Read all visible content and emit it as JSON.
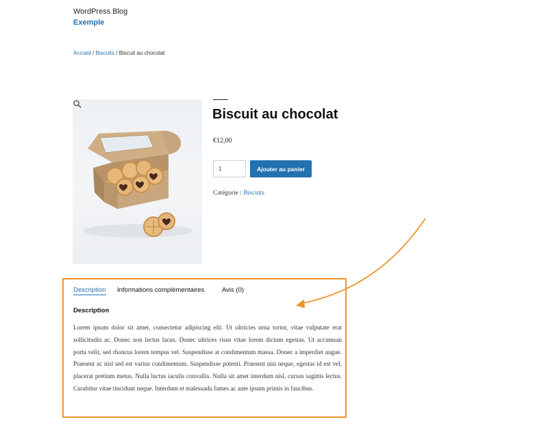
{
  "header": {
    "site_title": "WordPress Blog",
    "tagline": "Exemple"
  },
  "breadcrumb": {
    "home": "Accueil",
    "sep1": " / ",
    "category": "Biscuits",
    "sep2": " / ",
    "current": "Biscuit au chocolat"
  },
  "product": {
    "image_alt": "Biscuit au chocolat",
    "zoom_icon": "magnifier-icon",
    "title": "Biscuit au chocolat",
    "price": "€12,00",
    "quantity": "1",
    "add_to_cart_label": "Ajouter au panier",
    "category_label": "Catégorie : ",
    "category_value": "Biscuits"
  },
  "tabs": {
    "description": "Description",
    "additional_info": "Informations complémentaires",
    "reviews": "Avis (0)"
  },
  "description": {
    "heading": "Description",
    "body": "Lorem ipsum dolor sit amet, consectetur adipiscing elit. Ut ultricies urna tortor, vitae vulputate erat sollicitudin ac. Donec non lectus lacus. Donec ultrices risus vitae lorem dictum egestas. Ut accumsan porta velit, sed rhoncus lorem tempus vel. Suspendisse at condimentum massa. Donec a imperdiet augue. Praesent ac nisl sed est varius condimentum. Suspendisse potenti. Praesent nisi neque, egestas id est vel, placerat pretium metus. Nulla luctus iaculis convallis. Nulla sit amet interdum nisl, cursus sagittis lectus. Curabitur vitae tincidunt neque. Interdum et malesuada fames ac ante ipsum primis in faucibus."
  },
  "colors": {
    "link": "#2271b1",
    "button": "#2271b1",
    "annotation": "#f0932b"
  }
}
